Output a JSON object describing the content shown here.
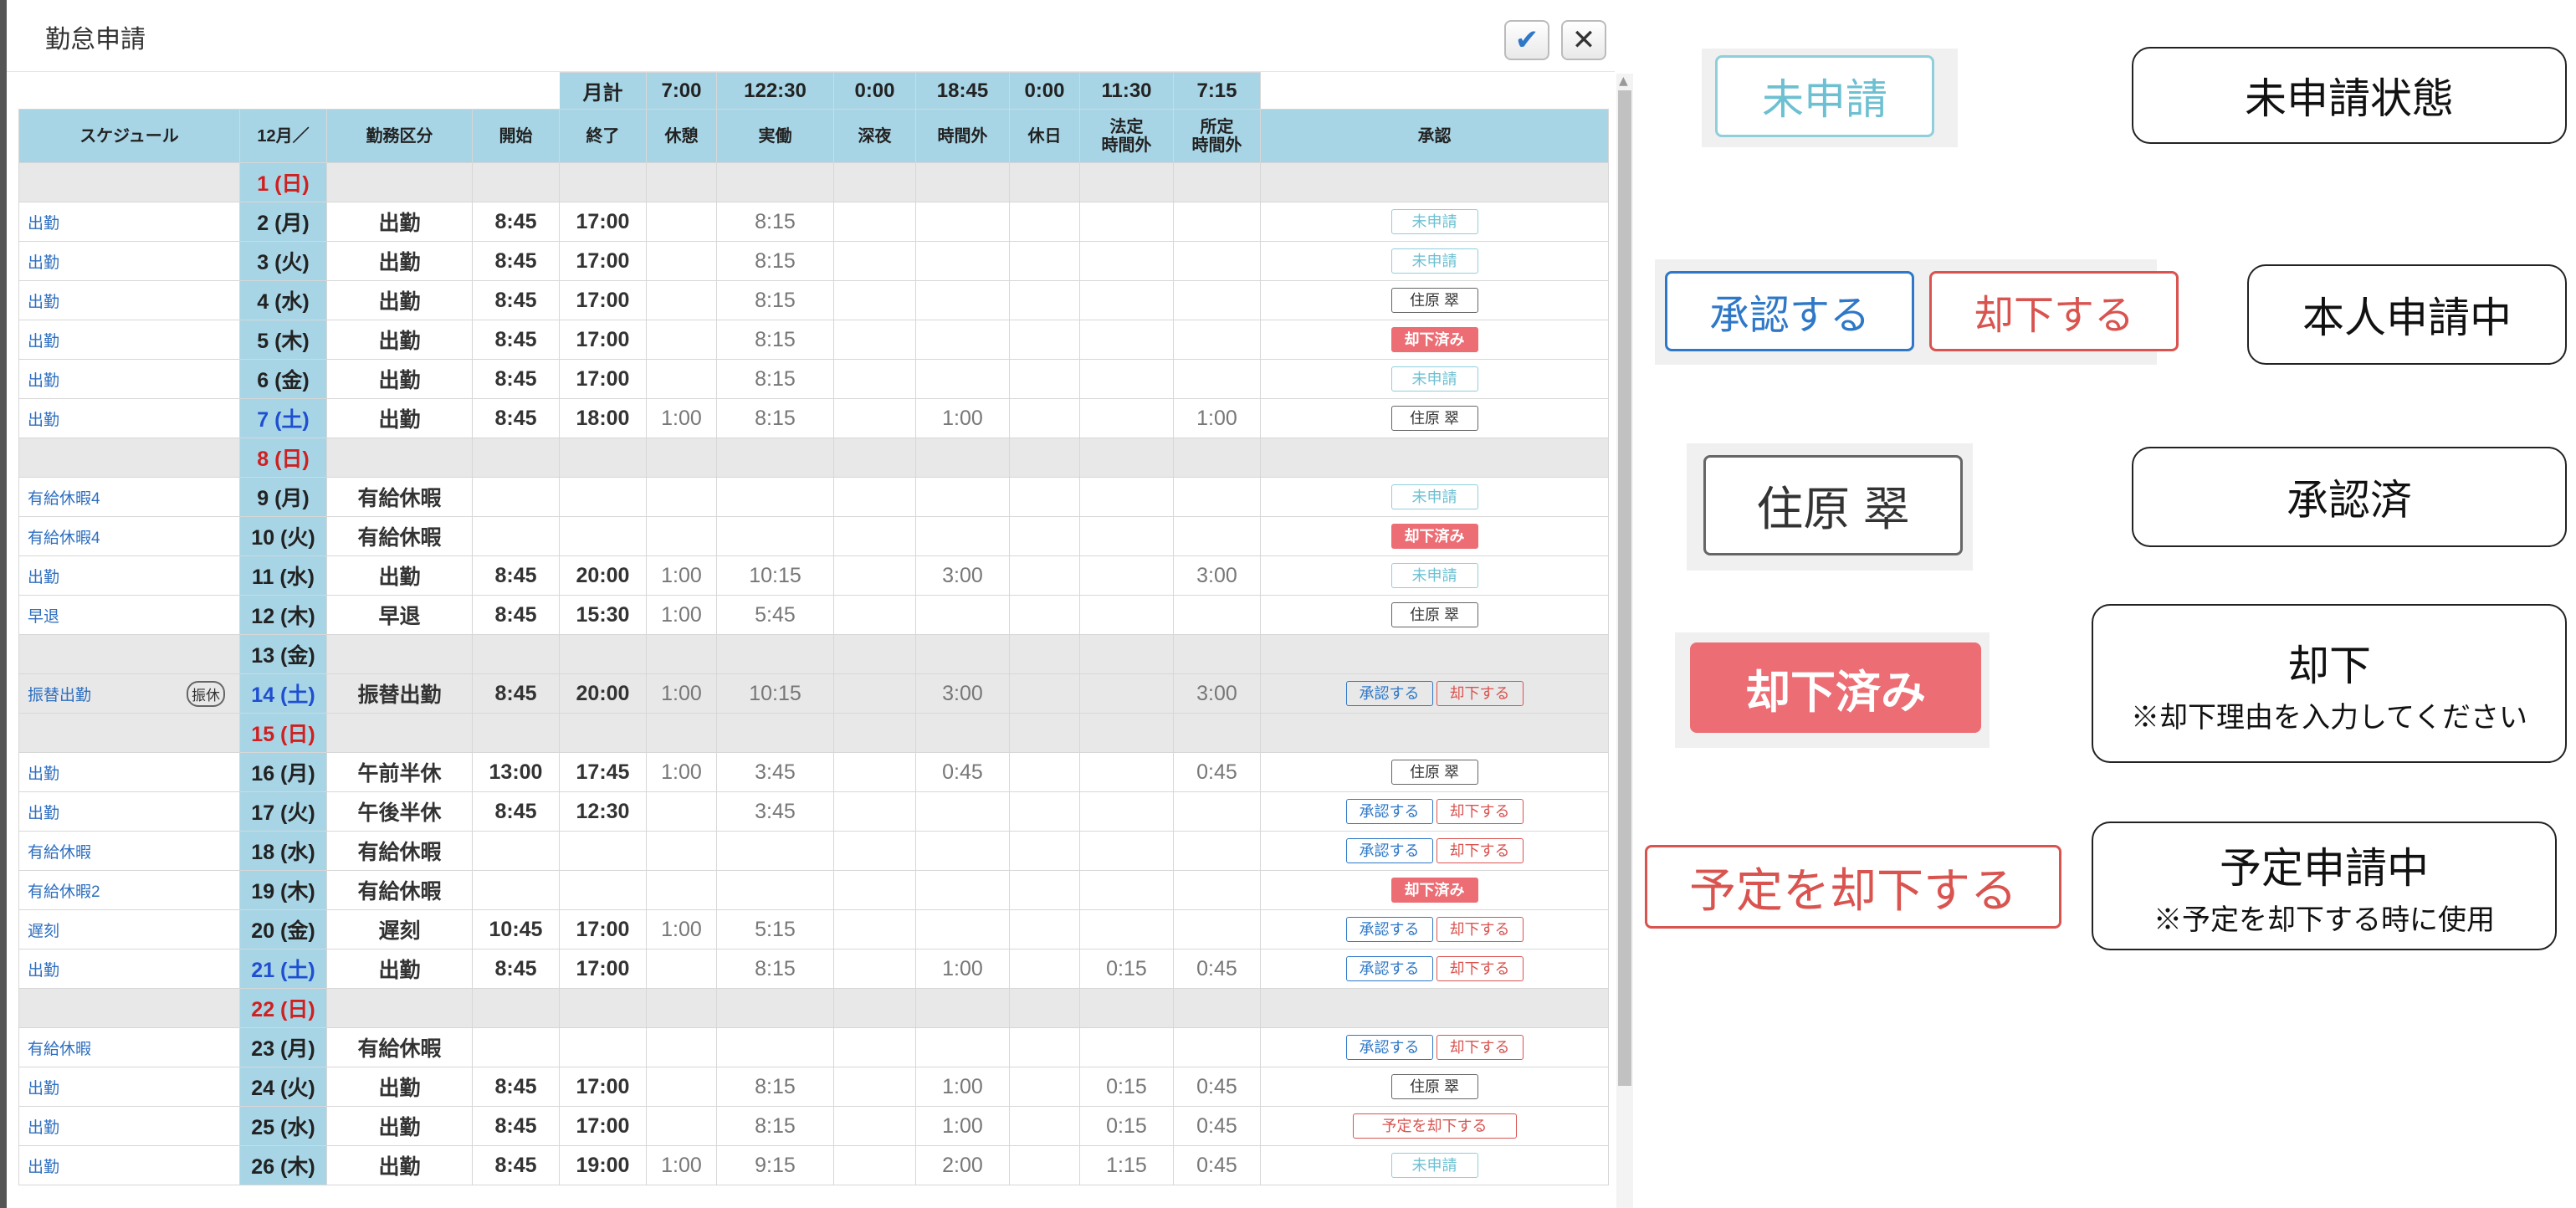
{
  "dialog": {
    "title": "勤怠申請",
    "ok_icon": "check-icon",
    "close_icon": "close-icon"
  },
  "totals": {
    "label": "月計",
    "values": [
      "7:00",
      "122:30",
      "0:00",
      "18:45",
      "0:00",
      "11:30",
      "7:15"
    ]
  },
  "headers": {
    "schedule": "スケジュール",
    "month": "12月／",
    "kubun": "勤務区分",
    "start": "開始",
    "end": "終了",
    "rest": "休憩",
    "actual": "実働",
    "night": "深夜",
    "overtime": "時間外",
    "holiday": "休日",
    "legal_ot_1": "法定",
    "legal_ot_2": "時間外",
    "sched_ot_1": "所定",
    "sched_ot_2": "時間外",
    "approval": "承認"
  },
  "chips": {
    "mi": "未申請",
    "ok": "承認する",
    "ng": "却下する",
    "ky": "却下済み",
    "yt": "予定を却下する",
    "furikyu": "振休"
  },
  "rows": [
    {
      "sch": "",
      "day": "1 (日)",
      "dow": "sun",
      "kbn": "",
      "start": "",
      "end": "",
      "rest": "",
      "actual": "",
      "night": "",
      "ot": "",
      "hol": "",
      "legal": "",
      "sched": "",
      "status": "none",
      "approver": "",
      "gray": true
    },
    {
      "sch": "出勤",
      "day": "2 (月)",
      "dow": "",
      "kbn": "出勤",
      "start": "8:45",
      "end": "17:00",
      "rest": "",
      "actual": "8:15",
      "night": "",
      "ot": "",
      "hol": "",
      "legal": "",
      "sched": "",
      "status": "mi",
      "approver": "",
      "gray": false
    },
    {
      "sch": "出勤",
      "day": "3 (火)",
      "dow": "",
      "kbn": "出勤",
      "start": "8:45",
      "end": "17:00",
      "rest": "",
      "actual": "8:15",
      "night": "",
      "ot": "",
      "hol": "",
      "legal": "",
      "sched": "",
      "status": "mi",
      "approver": "",
      "gray": false
    },
    {
      "sch": "出勤",
      "day": "4 (水)",
      "dow": "",
      "kbn": "出勤",
      "start": "8:45",
      "end": "17:00",
      "rest": "",
      "actual": "8:15",
      "night": "",
      "ot": "",
      "hol": "",
      "legal": "",
      "sched": "",
      "status": "sumi",
      "approver": "住原 翠",
      "gray": false
    },
    {
      "sch": "出勤",
      "day": "5 (木)",
      "dow": "",
      "kbn": "出勤",
      "start": "8:45",
      "end": "17:00",
      "rest": "",
      "actual": "8:15",
      "night": "",
      "ot": "",
      "hol": "",
      "legal": "",
      "sched": "",
      "status": "ky",
      "approver": "",
      "gray": false
    },
    {
      "sch": "出勤",
      "day": "6 (金)",
      "dow": "",
      "kbn": "出勤",
      "start": "8:45",
      "end": "17:00",
      "rest": "",
      "actual": "8:15",
      "night": "",
      "ot": "",
      "hol": "",
      "legal": "",
      "sched": "",
      "status": "mi",
      "approver": "",
      "gray": false
    },
    {
      "sch": "出勤",
      "day": "7 (土)",
      "dow": "sat",
      "kbn": "出勤",
      "start": "8:45",
      "end": "18:00",
      "rest": "1:00",
      "actual": "8:15",
      "night": "",
      "ot": "1:00",
      "hol": "",
      "legal": "",
      "sched": "1:00",
      "status": "sumi",
      "approver": "住原 翠",
      "gray": false
    },
    {
      "sch": "",
      "day": "8 (日)",
      "dow": "sun",
      "kbn": "",
      "start": "",
      "end": "",
      "rest": "",
      "actual": "",
      "night": "",
      "ot": "",
      "hol": "",
      "legal": "",
      "sched": "",
      "status": "none",
      "approver": "",
      "gray": true
    },
    {
      "sch": "有給休暇4",
      "day": "9 (月)",
      "dow": "",
      "kbn": "有給休暇",
      "start": "",
      "end": "",
      "rest": "",
      "actual": "",
      "night": "",
      "ot": "",
      "hol": "",
      "legal": "",
      "sched": "",
      "status": "mi",
      "approver": "",
      "gray": false
    },
    {
      "sch": "有給休暇4",
      "day": "10 (火)",
      "dow": "",
      "kbn": "有給休暇",
      "start": "",
      "end": "",
      "rest": "",
      "actual": "",
      "night": "",
      "ot": "",
      "hol": "",
      "legal": "",
      "sched": "",
      "status": "ky",
      "approver": "",
      "gray": false
    },
    {
      "sch": "出勤",
      "day": "11 (水)",
      "dow": "",
      "kbn": "出勤",
      "start": "8:45",
      "end": "20:00",
      "rest": "1:00",
      "actual": "10:15",
      "night": "",
      "ot": "3:00",
      "hol": "",
      "legal": "",
      "sched": "3:00",
      "status": "mi",
      "approver": "",
      "gray": false
    },
    {
      "sch": "早退",
      "day": "12 (木)",
      "dow": "",
      "kbn": "早退",
      "start": "8:45",
      "end": "15:30",
      "rest": "1:00",
      "actual": "5:45",
      "night": "",
      "ot": "",
      "hol": "",
      "legal": "",
      "sched": "",
      "status": "sumi",
      "approver": "住原 翠",
      "gray": false
    },
    {
      "sch": "",
      "day": "13 (金)",
      "dow": "",
      "kbn": "",
      "start": "",
      "end": "",
      "rest": "",
      "actual": "",
      "night": "",
      "ot": "",
      "hol": "",
      "legal": "",
      "sched": "",
      "status": "none",
      "approver": "",
      "gray": true
    },
    {
      "sch": "振替出勤",
      "day": "14 (土)",
      "dow": "sat",
      "kbn": "振替出勤",
      "start": "8:45",
      "end": "20:00",
      "rest": "1:00",
      "actual": "10:15",
      "night": "",
      "ot": "3:00",
      "hol": "",
      "legal": "",
      "sched": "3:00",
      "status": "pending",
      "approver": "",
      "gray": true,
      "furikyu": true
    },
    {
      "sch": "",
      "day": "15 (日)",
      "dow": "sun",
      "kbn": "",
      "start": "",
      "end": "",
      "rest": "",
      "actual": "",
      "night": "",
      "ot": "",
      "hol": "",
      "legal": "",
      "sched": "",
      "status": "none",
      "approver": "",
      "gray": true
    },
    {
      "sch": "出勤",
      "day": "16 (月)",
      "dow": "",
      "kbn": "午前半休",
      "start": "13:00",
      "end": "17:45",
      "rest": "1:00",
      "actual": "3:45",
      "night": "",
      "ot": "0:45",
      "hol": "",
      "legal": "",
      "sched": "0:45",
      "status": "sumi",
      "approver": "住原 翠",
      "gray": false
    },
    {
      "sch": "出勤",
      "day": "17 (火)",
      "dow": "",
      "kbn": "午後半休",
      "start": "8:45",
      "end": "12:30",
      "rest": "",
      "actual": "3:45",
      "night": "",
      "ot": "",
      "hol": "",
      "legal": "",
      "sched": "",
      "status": "pending",
      "approver": "",
      "gray": false
    },
    {
      "sch": "有給休暇",
      "day": "18 (水)",
      "dow": "",
      "kbn": "有給休暇",
      "start": "",
      "end": "",
      "rest": "",
      "actual": "",
      "night": "",
      "ot": "",
      "hol": "",
      "legal": "",
      "sched": "",
      "status": "pending",
      "approver": "",
      "gray": false
    },
    {
      "sch": "有給休暇2",
      "day": "19 (木)",
      "dow": "",
      "kbn": "有給休暇",
      "start": "",
      "end": "",
      "rest": "",
      "actual": "",
      "night": "",
      "ot": "",
      "hol": "",
      "legal": "",
      "sched": "",
      "status": "ky",
      "approver": "",
      "gray": false
    },
    {
      "sch": "遅刻",
      "day": "20 (金)",
      "dow": "",
      "kbn": "遅刻",
      "start": "10:45",
      "end": "17:00",
      "rest": "1:00",
      "actual": "5:15",
      "night": "",
      "ot": "",
      "hol": "",
      "legal": "",
      "sched": "",
      "status": "pending",
      "approver": "",
      "gray": false
    },
    {
      "sch": "出勤",
      "day": "21 (土)",
      "dow": "sat",
      "kbn": "出勤",
      "start": "8:45",
      "end": "17:00",
      "rest": "",
      "actual": "8:15",
      "night": "",
      "ot": "1:00",
      "hol": "",
      "legal": "0:15",
      "sched": "0:45",
      "status": "pending",
      "approver": "",
      "gray": false
    },
    {
      "sch": "",
      "day": "22 (日)",
      "dow": "sun",
      "kbn": "",
      "start": "",
      "end": "",
      "rest": "",
      "actual": "",
      "night": "",
      "ot": "",
      "hol": "",
      "legal": "",
      "sched": "",
      "status": "none",
      "approver": "",
      "gray": true
    },
    {
      "sch": "有給休暇",
      "day": "23 (月)",
      "dow": "",
      "kbn": "有給休暇",
      "start": "",
      "end": "",
      "rest": "",
      "actual": "",
      "night": "",
      "ot": "",
      "hol": "",
      "legal": "",
      "sched": "",
      "status": "pending",
      "approver": "",
      "gray": false
    },
    {
      "sch": "出勤",
      "day": "24 (火)",
      "dow": "",
      "kbn": "出勤",
      "start": "8:45",
      "end": "17:00",
      "rest": "",
      "actual": "8:15",
      "night": "",
      "ot": "1:00",
      "hol": "",
      "legal": "0:15",
      "sched": "0:45",
      "status": "sumi",
      "approver": "住原 翠",
      "gray": false
    },
    {
      "sch": "出勤",
      "day": "25 (水)",
      "dow": "",
      "kbn": "出勤",
      "start": "8:45",
      "end": "17:00",
      "rest": "",
      "actual": "8:15",
      "night": "",
      "ot": "1:00",
      "hol": "",
      "legal": "0:15",
      "sched": "0:45",
      "status": "yt",
      "approver": "",
      "gray": false
    },
    {
      "sch": "出勤",
      "day": "26 (木)",
      "dow": "",
      "kbn": "出勤",
      "start": "8:45",
      "end": "19:00",
      "rest": "1:00",
      "actual": "9:15",
      "night": "",
      "ot": "2:00",
      "hol": "",
      "legal": "1:15",
      "sched": "0:45",
      "status": "mi",
      "approver": "",
      "gray": false
    }
  ],
  "legend": {
    "chip_mi": "未申請",
    "chip_ok": "承認する",
    "chip_ng": "却下する",
    "chip_sumi": "住原 翠",
    "chip_ky": "却下済み",
    "chip_yt": "予定を却下する",
    "box1": "未申請状態",
    "box2": "本人申請中",
    "box3": "承認済",
    "box4_title": "却下",
    "box4_note": "※却下理由を入力してください",
    "box5_title": "予定申請中",
    "box5_note": "※予定を却下する時に使用"
  },
  "colors": {
    "header_bg": "#a7d5e6",
    "mi": "#6cc0d2",
    "approve": "#2e78c7",
    "reject": "#d9534f",
    "rejected_fill": "#ec6d74",
    "sunday": "#d01f1f",
    "saturday": "#1f4fd0"
  }
}
